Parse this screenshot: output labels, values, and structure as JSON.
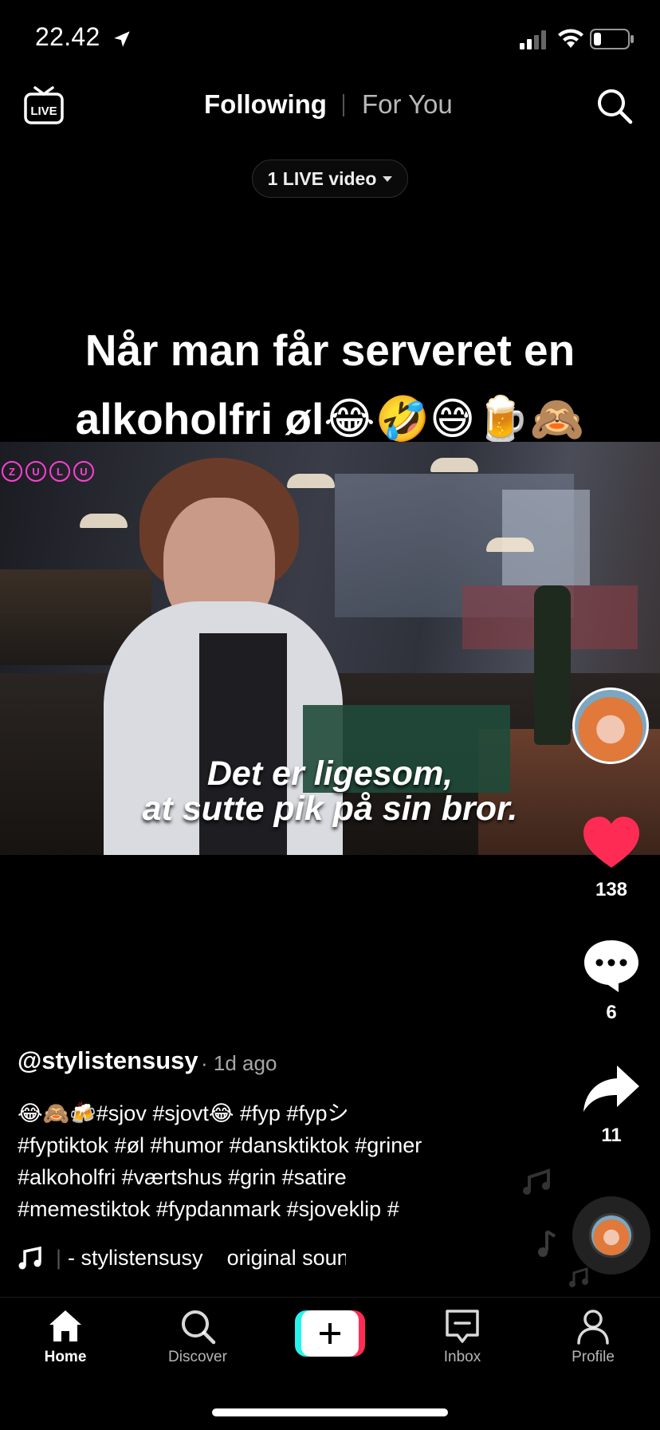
{
  "status_bar": {
    "time": "22.42"
  },
  "top_nav": {
    "live_icon_label": "LIVE",
    "tab_following": "Following",
    "tab_for_you": "For You",
    "live_pill": "1 LIVE video"
  },
  "video": {
    "caption_lines": [
      "Når man får serveret en",
      "alkoholfri øl😂🤣😅🍺🙈"
    ],
    "watermark": [
      "Z",
      "U",
      "L",
      "U"
    ],
    "subtitle_lines": [
      "Det er ligesom,",
      "at sutte pik på sin bror."
    ]
  },
  "rail": {
    "likes": "138",
    "comments": "6",
    "shares": "11"
  },
  "post": {
    "username": "@stylistensusy",
    "time_ago": "· 1d ago",
    "description_lines": [
      "😂🙈🍻#sjov #sjovt😂 #fyp #fypシ",
      "#fyptiktok #øl #humor #dansktiktok #griner",
      "#alkoholfri #værtshus #grin #satire",
      "#memestiktok #fypdanmark #sjoveklip #"
    ],
    "sound_separator": "|",
    "sound_text": "- stylistensusy    original sound"
  },
  "bottom_nav": {
    "home": "Home",
    "discover": "Discover",
    "inbox": "Inbox",
    "profile": "Profile"
  },
  "colors": {
    "like": "#fe2c55",
    "create_left": "#25f4ee",
    "create_right": "#fe2c55"
  },
  "icons": [
    "location-arrow-icon",
    "signal-icon",
    "wifi-icon",
    "battery-icon",
    "live-tv-icon",
    "search-icon",
    "heart-icon",
    "comment-icon",
    "share-icon",
    "music-note-icon",
    "home-icon",
    "discover-icon",
    "plus-icon",
    "inbox-icon",
    "profile-icon"
  ]
}
